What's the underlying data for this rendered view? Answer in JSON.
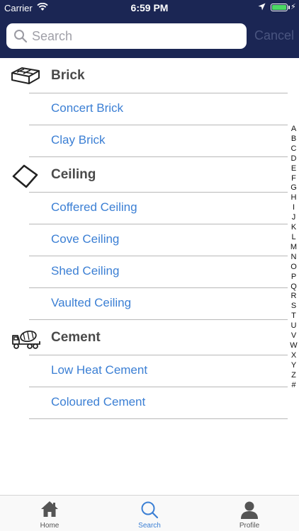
{
  "status_bar": {
    "carrier": "Carrier",
    "time": "6:59 PM",
    "battery_level": 1.0
  },
  "search": {
    "placeholder": "Search",
    "value": "",
    "cancel_label": "Cancel"
  },
  "sections": [
    {
      "title": "Brick",
      "icon": "brick-icon",
      "items": [
        "Concert Brick",
        "Clay Brick"
      ]
    },
    {
      "title": "Ceiling",
      "icon": "ceiling-icon",
      "items": [
        "Coffered Ceiling",
        "Cove Ceiling",
        "Shed Ceiling",
        "Vaulted Ceiling"
      ]
    },
    {
      "title": "Cement",
      "icon": "cement-truck-icon",
      "items": [
        "Low Heat Cement",
        "Coloured Cement"
      ]
    }
  ],
  "index_letters": [
    "A",
    "B",
    "C",
    "D",
    "E",
    "F",
    "G",
    "H",
    "I",
    "J",
    "K",
    "L",
    "M",
    "N",
    "O",
    "P",
    "Q",
    "R",
    "S",
    "T",
    "U",
    "V",
    "W",
    "X",
    "Y",
    "Z",
    "#"
  ],
  "tabs": [
    {
      "label": "Home",
      "icon": "home-icon",
      "active": false
    },
    {
      "label": "Search",
      "icon": "search-icon",
      "active": true
    },
    {
      "label": "Profile",
      "icon": "profile-icon",
      "active": false
    }
  ],
  "colors": {
    "header": "#1b2654",
    "link": "#3b7fd4",
    "title": "#4a4a4a",
    "battery": "#4cd964"
  }
}
